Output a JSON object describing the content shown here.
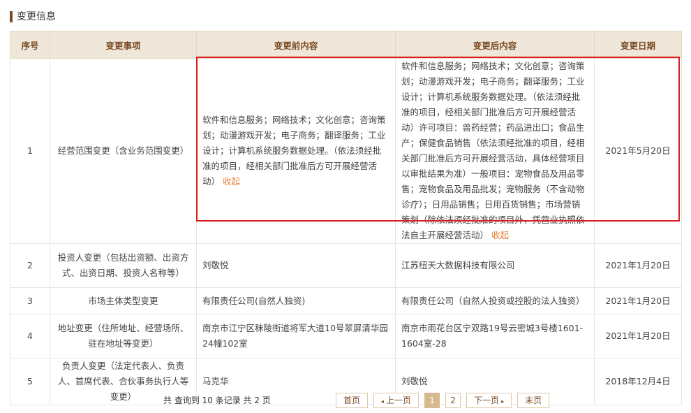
{
  "section": {
    "title": "变更信息"
  },
  "table": {
    "headers": {
      "no": "序号",
      "item": "变更事项",
      "before": "变更前内容",
      "after": "变更后内容",
      "date": "变更日期"
    },
    "rows": [
      {
        "no": "1",
        "item": "经营范围变更（含业务范围变更）",
        "before": "软件和信息服务；网络技术；文化创意；咨询策划；动漫游戏开发；电子商务；翻译服务；工业设计；计算机系统服务数据处理。（依法须经批准的项目，经相关部门批准后方可开展经营活动）",
        "before_link": "收起",
        "after": "软件和信息服务；网络技术；文化创意；咨询策划；动漫游戏开发；电子商务；翻译服务；工业设计；计算机系统服务数据处理。（依法须经批准的项目，经相关部门批准后方可开展经营活动）许可项目：兽药经营；药品进出口；食品生产；保健食品销售（依法须经批准的项目，经相关部门批准后方可开展经营活动，具体经营项目以审批结果为准）一般项目：宠物食品及用品零售；宠物食品及用品批发；宠物服务（不含动物诊疗）；日用品销售；日用百货销售；市场营销策划（除依法须经批准的项目外，凭营业执照依法自主开展经营活动）",
        "after_link": "收起",
        "date": "2021年5月20日"
      },
      {
        "no": "2",
        "item": "投资人变更（包括出资额、出资方式、出资日期、投资人名称等）",
        "before": "刘敬悦",
        "after": "江苏纽天大数据科技有限公司",
        "date": "2021年1月20日"
      },
      {
        "no": "3",
        "item": "市场主体类型变更",
        "before": "有限责任公司(自然人独资)",
        "after": "有限责任公司（自然人投资或控股的法人独资）",
        "date": "2021年1月20日"
      },
      {
        "no": "4",
        "item": "地址变更（住所地址、经营场所、驻在地址等变更）",
        "before": "南京市江宁区秣陵街道将军大道10号翠屏清华园24幢102室",
        "after": "南京市雨花台区宁双路19号云密城3号楼1601-1604室-28",
        "date": "2021年1月20日"
      },
      {
        "no": "5",
        "item": "负责人变更（法定代表人、负责人、首席代表、合伙事务执行人等变更）",
        "before": "马克华",
        "after": "刘敬悦",
        "date": "2018年12月4日"
      }
    ]
  },
  "footer": {
    "count_text": "共 查询到 10 条记录 共 2 页",
    "pager": {
      "first": "首页",
      "prev": "上一页",
      "pages": [
        "1",
        "2"
      ],
      "active_page": "1",
      "next": "下一页",
      "last": "末页"
    }
  },
  "colors": {
    "header_bg": "#efe7d9",
    "header_text": "#7a4a24",
    "highlight": "#e01b1b",
    "link": "#e8823a",
    "active_page": "#d7b98f"
  }
}
